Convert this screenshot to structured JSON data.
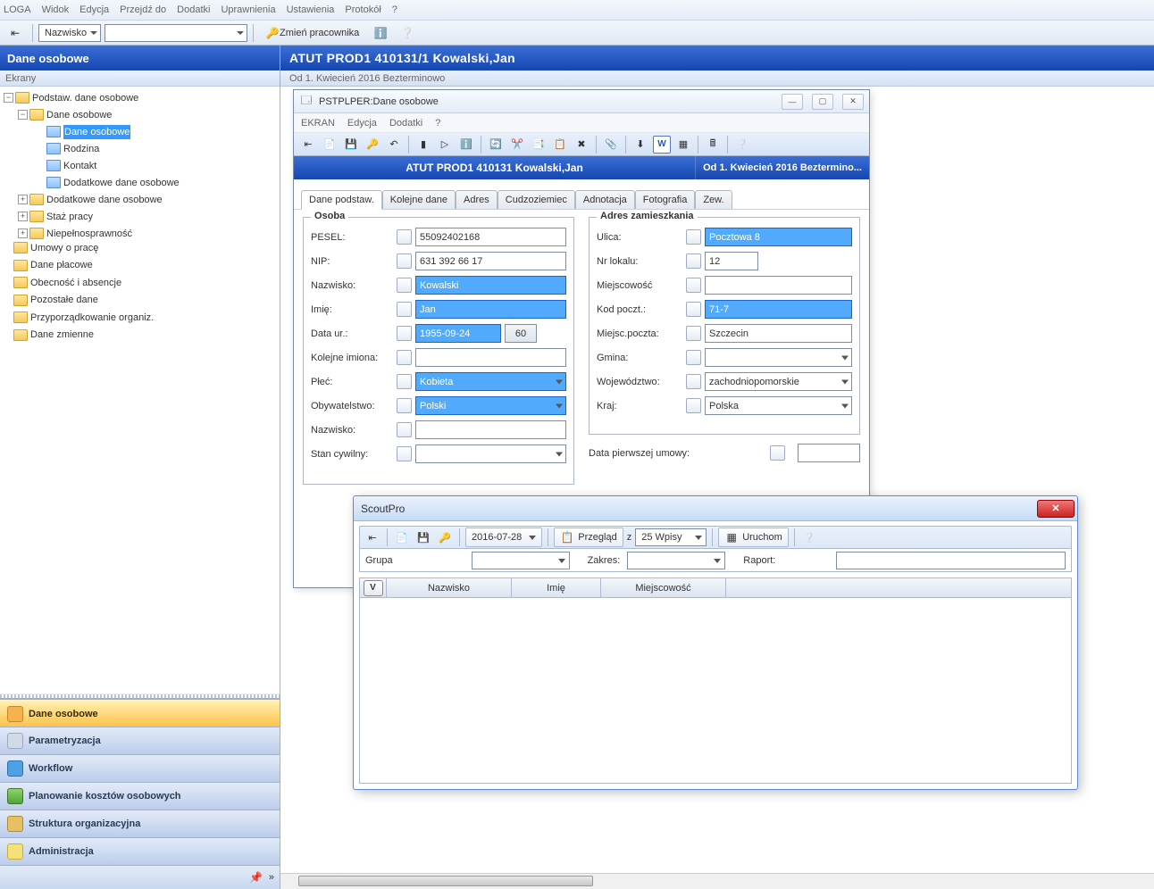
{
  "main_menu": [
    "LOGA",
    "Widok",
    "Edycja",
    "Przejdź do",
    "Dodatki",
    "Uprawnienia",
    "Ustawienia",
    "Protokół",
    "?"
  ],
  "main_toolbar": {
    "name_field_label": "Nazwisko",
    "change_employee": "Zmień pracownika"
  },
  "left": {
    "title": "Dane osobowe",
    "subtitle": "Ekrany",
    "tree": {
      "root": "Podstaw. dane osobowe",
      "dane_osobowe": "Dane osobowe",
      "dane_osobowe_sel": "Dane osobowe",
      "rodzina": "Rodzina",
      "kontakt": "Kontakt",
      "dodatkowe1": "Dodatkowe dane osobowe",
      "dodatkowe2": "Dodatkowe dane osobowe",
      "staz": "Staż pracy",
      "niepeln": "Niepełnosprawność",
      "umowy": "Umowy o pracę",
      "placowe": "Dane płacowe",
      "obecnosc": "Obecność i absencje",
      "pozostale": "Pozostałe dane",
      "przyporz": "Przyporządkowanie organiz.",
      "zmienne": "Dane zmienne"
    },
    "nav": [
      "Dane osobowe",
      "Parametryzacja",
      "Workflow",
      "Planowanie kosztów osobowych",
      "Struktura organizacyjna",
      "Administracja"
    ]
  },
  "right": {
    "title": "ATUT   PROD1   410131/1   Kowalski,Jan",
    "subtitle": "Od 1. Kwiecień 2016 Bezterminowo"
  },
  "win1": {
    "title": "PSTPLPER:Dane osobowe",
    "menu": [
      "EKRAN",
      "Edycja",
      "Dodatki",
      "?"
    ],
    "bluebar_left": "ATUT   PROD1   410131   Kowalski,Jan",
    "bluebar_right": "Od 1. Kwiecień 2016 Beztermino...",
    "tabs": [
      "Dane podstaw.",
      "Kolejne dane",
      "Adres",
      "Cudzoziemiec",
      "Adnotacja",
      "Fotografia",
      "Zew."
    ],
    "osoba_legend": "Osoba",
    "adres_legend": "Adres zamieszkania",
    "labels": {
      "pesel": "PESEL:",
      "nip": "NIP:",
      "nazwisko": "Nazwisko:",
      "imie": "Imię:",
      "data_ur": "Data ur.:",
      "kolejne_imiona": "Kolejne imiona:",
      "plec": "Płeć:",
      "obywatelstwo": "Obywatelstwo:",
      "nazwisko2": "Nazwisko:",
      "stan": "Stan cywilny:",
      "ulica": "Ulica:",
      "nr_lokalu": "Nr lokalu:",
      "miejscowosc": "Miejscowość",
      "kod": "Kod poczt.:",
      "miejsc_poczta": "Miejsc.poczta:",
      "gmina": "Gmina:",
      "woj": "Województwo:",
      "kraj": "Kraj:",
      "first_contract": "Data pierwszej umowy:"
    },
    "values": {
      "pesel": "55092402168",
      "nip": "631 392 66 17",
      "nazwisko": "Kowalski",
      "imie": "Jan",
      "data_ur": "1955-09-24",
      "age": "60",
      "kolejne_imiona": "",
      "plec": "Kobieta",
      "obywatelstwo": "Polski",
      "nazwisko2": "",
      "stan": "",
      "ulica": "Pocztowa 8",
      "nr_lokalu": "12",
      "miejscowosc": "",
      "kod": "71-7",
      "miejsc_poczta": "Szczecin",
      "gmina": "",
      "woj": "zachodniopomorskie",
      "kraj": "Polska",
      "first_contract": ""
    }
  },
  "win2": {
    "title": "ScoutPro",
    "date": "2016-07-28",
    "przeglad": "Przegląd",
    "z": "z",
    "entries_value": "25 Wpisy",
    "run": "Uruchom",
    "grupa_lbl": "Grupa",
    "zakres_lbl": "Zakres:",
    "raport_lbl": "Raport:",
    "grid_v": "V",
    "grid_cols": [
      "Nazwisko",
      "Imię",
      "Miejscowość"
    ]
  }
}
